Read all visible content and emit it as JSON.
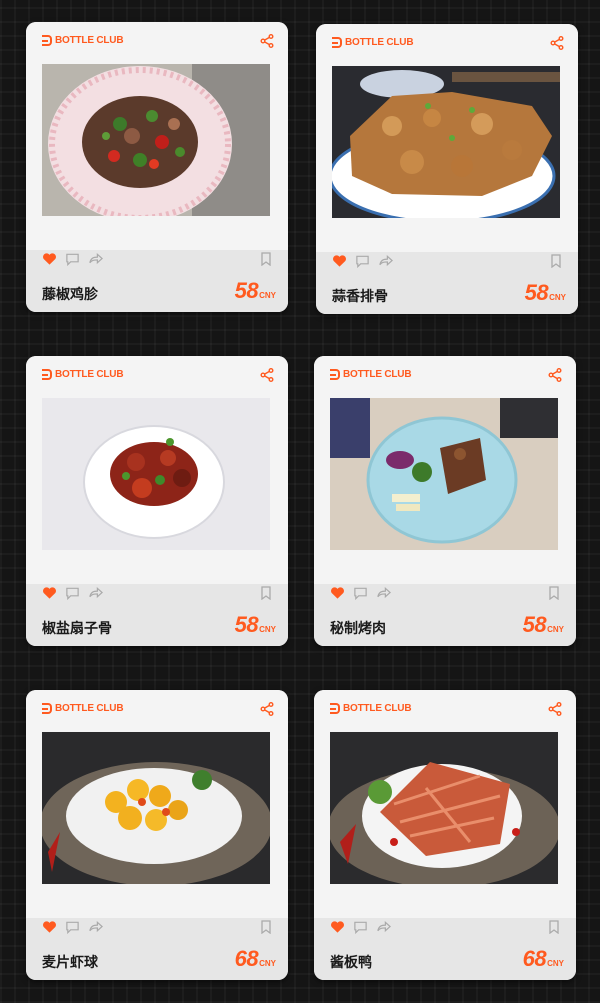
{
  "brand": {
    "name": "BOTTLE CLUB",
    "color": "#ff5a1f"
  },
  "icons": {
    "share": "share-icon",
    "like": "heart-icon",
    "comment": "comment-icon",
    "forward": "forward-icon",
    "save": "bookmark-icon"
  },
  "cards": [
    {
      "name": "藤椒鸡胗",
      "price": "58",
      "currency": "CNY"
    },
    {
      "name": "蒜香排骨",
      "price": "58",
      "currency": "CNY"
    },
    {
      "name": "椒盐扇子骨",
      "price": "58",
      "currency": "CNY"
    },
    {
      "name": "秘制烤肉",
      "price": "58",
      "currency": "CNY"
    },
    {
      "name": "麦片虾球",
      "price": "68",
      "currency": "CNY"
    },
    {
      "name": "酱板鸭",
      "price": "68",
      "currency": "CNY"
    }
  ]
}
